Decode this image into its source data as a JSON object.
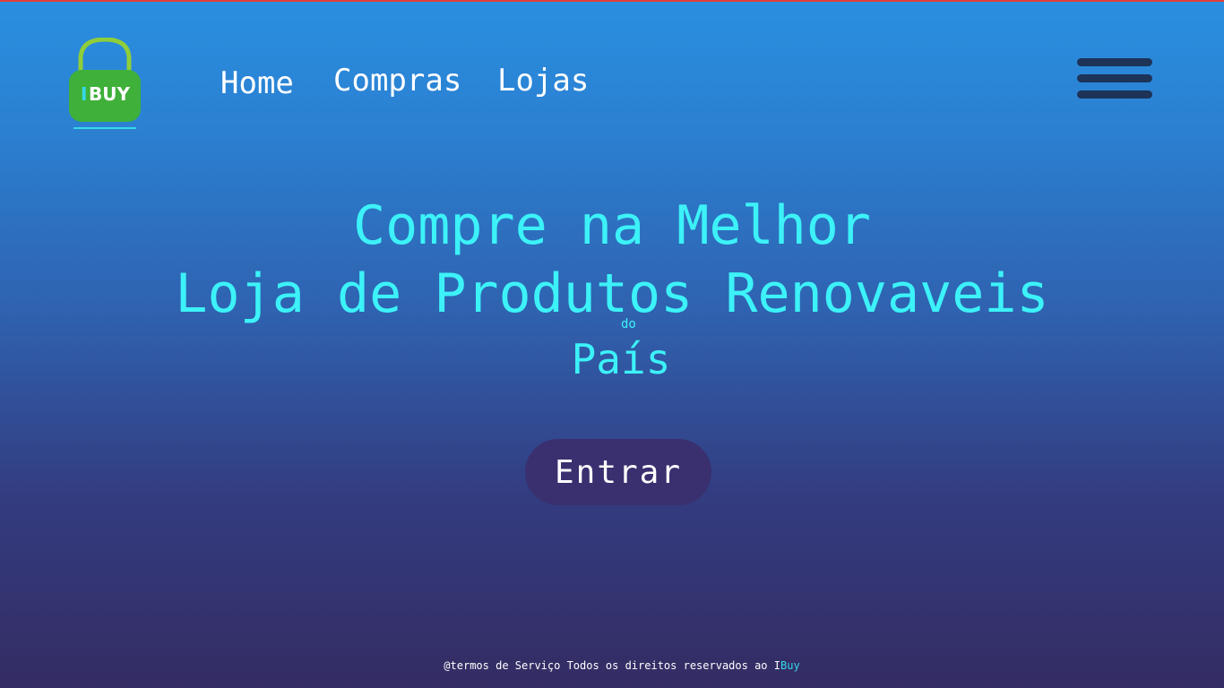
{
  "logo": {
    "text_i": "I",
    "text_buy": "BUY",
    "icon": "shopping-bag-lock-icon",
    "colors": {
      "bag": "#3fb039",
      "handle": "#8fce3a",
      "letter_i": "#35d7e8",
      "letters": "#ffffff"
    }
  },
  "nav": {
    "items": [
      {
        "label": "Home"
      },
      {
        "label": "Compras"
      },
      {
        "label": "Lojas"
      }
    ],
    "menu_icon": "hamburger-menu-icon"
  },
  "hero": {
    "line1": "Compre na Melhor",
    "line2": "Loja de Produtos Renovaveis",
    "small": "do",
    "line3": "País"
  },
  "cta": {
    "label": "Entrar"
  },
  "footer": {
    "text": "@termos de Serviço Todos os direitos reservados ao ",
    "brand_i": "I",
    "brand_rest": "Buy"
  },
  "colors": {
    "accent": "#3cf2f8",
    "button_bg": "#3a2f6f",
    "menu_bars": "#1d3357",
    "top_line": "#e0403a"
  }
}
